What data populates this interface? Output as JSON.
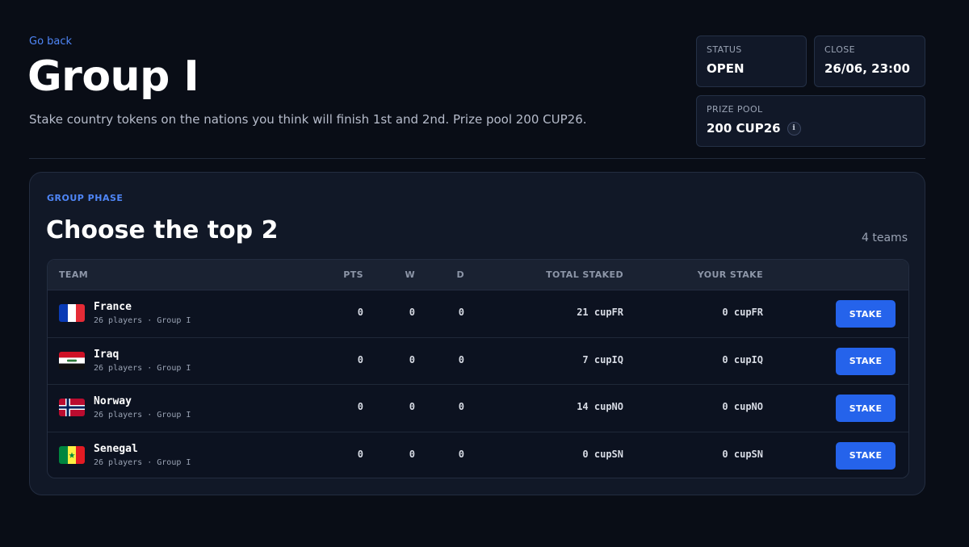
{
  "header": {
    "back_label": "Go back",
    "title": "Group I",
    "description": "Stake country tokens on the nations you think will finish 1st and 2nd. Prize pool 200 CUP26."
  },
  "info": {
    "status_label": "STATUS",
    "status_value": "OPEN",
    "close_label": "CLOSE",
    "close_value": "26/06, 23:00",
    "prize_label": "PRIZE POOL",
    "prize_value": "200 CUP26",
    "info_icon": "i"
  },
  "panel": {
    "eyebrow": "GROUP PHASE",
    "title": "Choose the top 2",
    "team_count": "4 teams"
  },
  "table": {
    "headers": {
      "team": "TEAM",
      "pts": "PTS",
      "w": "W",
      "d": "D",
      "total": "TOTAL STAKED",
      "your": "YOUR STAKE"
    },
    "stake_label": "STAKE",
    "rows": [
      {
        "name": "France",
        "meta": "26 players · Group I",
        "pts": "0",
        "w": "0",
        "d": "0",
        "total": "21 cupFR",
        "your": "0 cupFR",
        "flag": "france-flag-icon"
      },
      {
        "name": "Iraq",
        "meta": "26 players · Group I",
        "pts": "0",
        "w": "0",
        "d": "0",
        "total": "7 cupIQ",
        "your": "0 cupIQ",
        "flag": "iraq-flag-icon"
      },
      {
        "name": "Norway",
        "meta": "26 players · Group I",
        "pts": "0",
        "w": "0",
        "d": "0",
        "total": "14 cupNO",
        "your": "0 cupNO",
        "flag": "norway-flag-icon"
      },
      {
        "name": "Senegal",
        "meta": "26 players · Group I",
        "pts": "0",
        "w": "0",
        "d": "0",
        "total": "0 cupSN",
        "your": "0 cupSN",
        "flag": "senegal-flag-icon"
      }
    ]
  },
  "colors": {
    "background": "#090d16",
    "accent": "#2563eb",
    "link": "#4f86f7"
  }
}
